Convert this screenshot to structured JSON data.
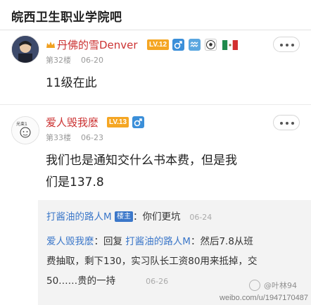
{
  "header": {
    "title": "皖西卫生职业学院吧"
  },
  "posts": [
    {
      "username": "丹佛的雪Denver",
      "level": "LV.12",
      "floor": "第32楼",
      "date": "06-20",
      "content": "11级在此"
    },
    {
      "username": "爱人毁我麽",
      "level": "LV.13",
      "floor": "第33楼",
      "date": "06-23",
      "content_line1": "我们也是通知交什么书本费，但是我",
      "content_line2": "们是137.8"
    }
  ],
  "replies": [
    {
      "author": "打酱油的路人M",
      "badge": "楼主",
      "text": "：你们更坑",
      "time": "06-24"
    },
    {
      "author": "爱人毁我麽",
      "prefix": "：回复 ",
      "target": "打酱油的路人M",
      "line1": "：然后7.8从班",
      "line2": "费抽取，剩下130，实习队长工资80用来抵掉，交",
      "line3": "50……贵的一持",
      "time": "06-26"
    }
  ],
  "watermark": {
    "handle": "@叶林94",
    "url": "weibo.com/u/1947170487"
  },
  "colors": {
    "username": "#cc3333",
    "link": "#3b77c9",
    "level_badge": "#f5a623",
    "louzhu_badge": "#3b77c9"
  },
  "icons": [
    "vip-crown-icon",
    "male-icon",
    "aquarius-icon",
    "soccer-icon",
    "mexico-flag-icon",
    "more-icon"
  ]
}
